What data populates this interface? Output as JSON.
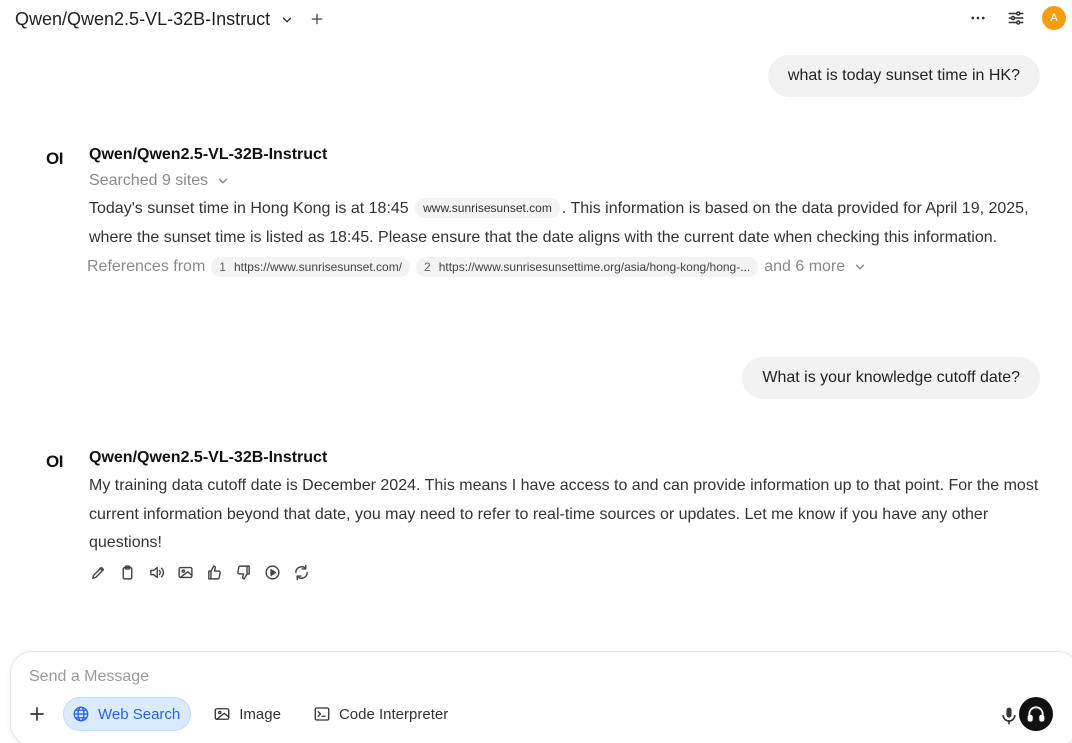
{
  "header": {
    "model_name": "Qwen/Qwen2.5-VL-32B-Instruct",
    "avatar_initial": "A"
  },
  "conversation": {
    "user_message_1": "what is today sunset time in HK?",
    "assistant_1": {
      "logo": "OI",
      "name": "Qwen/Qwen2.5-VL-32B-Instruct",
      "searched_label": "Searched 9 sites",
      "text_before_chip": "Today's sunset time in Hong Kong is at 18:45",
      "source_chip": "www.sunrisesunset.com",
      "text_after_chip": ". This information is based on the data provided for April 19, 2025, where the sunset time is listed as 18:45. Please ensure that the date aligns with the current date when checking this information.",
      "references_label": "References from",
      "references": [
        {
          "num": "1",
          "url": "https://www.sunrisesunset.com/"
        },
        {
          "num": "2",
          "url": "https://www.sunrisesunsettime.org/asia/hong-kong/hong-..."
        }
      ],
      "more_label": "and 6 more"
    },
    "user_message_2": "What is your knowledge cutoff date?",
    "assistant_2": {
      "logo": "OI",
      "name": "Qwen/Qwen2.5-VL-32B-Instruct",
      "text": "My training data cutoff date is December 2024. This means I have access to and can provide information up to that point. For the most current information beyond that date, you may need to refer to real-time sources or updates. Let me know if you have any other questions!"
    }
  },
  "composer": {
    "placeholder": "Send a Message",
    "web_search_label": "Web Search",
    "image_label": "Image",
    "code_interpreter_label": "Code Interpreter"
  },
  "colors": {
    "accent": "#2563eb",
    "avatar": "#f59e0b",
    "bubble": "#f2f2f2"
  }
}
